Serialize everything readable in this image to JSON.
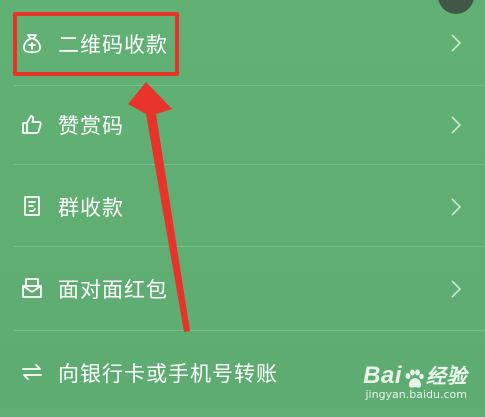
{
  "menu": {
    "items": [
      {
        "label": "二维码收款",
        "icon": "money-bag-icon"
      },
      {
        "label": "赞赏码",
        "icon": "thumbs-up-icon"
      },
      {
        "label": "群收款",
        "icon": "receipt-icon"
      },
      {
        "label": "面对面红包",
        "icon": "red-packet-icon"
      },
      {
        "label": "向银行卡或手机号转账",
        "icon": "transfer-icon"
      }
    ]
  },
  "watermark": {
    "brand_left": "Bai",
    "brand_right": "经验",
    "url": "jingyan.baidu.com"
  },
  "colors": {
    "background": "#5fae73",
    "highlight": "#e8332a",
    "arrow": "#e8332a"
  }
}
